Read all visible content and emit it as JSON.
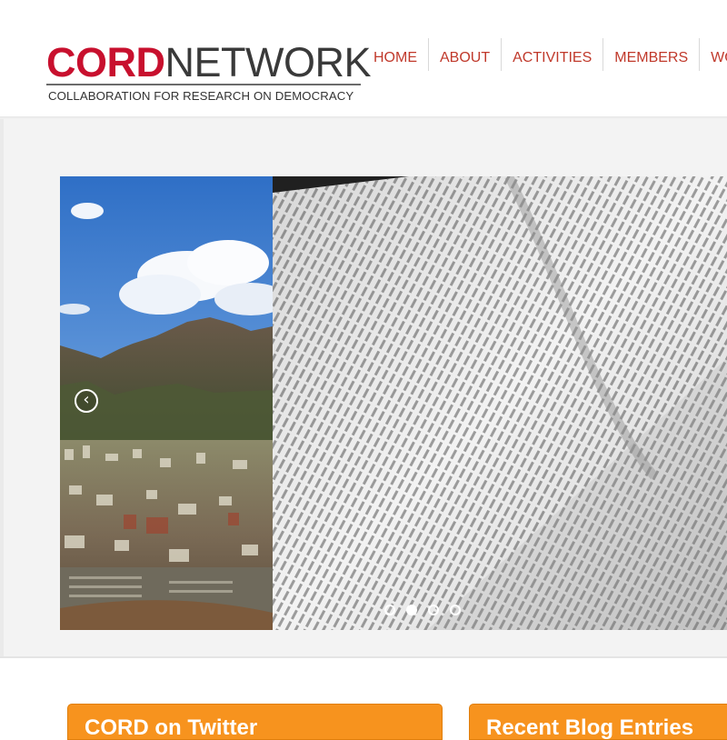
{
  "logo": {
    "word_cord": "CORD",
    "word_network": "NETWORK",
    "tagline": "COLLABORATION FOR RESEARCH ON DEMOCRACY"
  },
  "nav": {
    "items": [
      "HOME",
      "ABOUT",
      "ACTIVITIES",
      "MEMBERS",
      "WO"
    ]
  },
  "slider": {
    "prev_icon": "chevron-left-icon",
    "prev_glyph": "‹",
    "dot_count": 4,
    "active_dot": 2
  },
  "widgets": {
    "twitter_title": "CORD on Twitter",
    "blog_title": "Recent Blog Entries"
  },
  "colors": {
    "brand_red": "#c8102e",
    "nav_red": "#c0392b",
    "widget_orange": "#f7931e"
  }
}
